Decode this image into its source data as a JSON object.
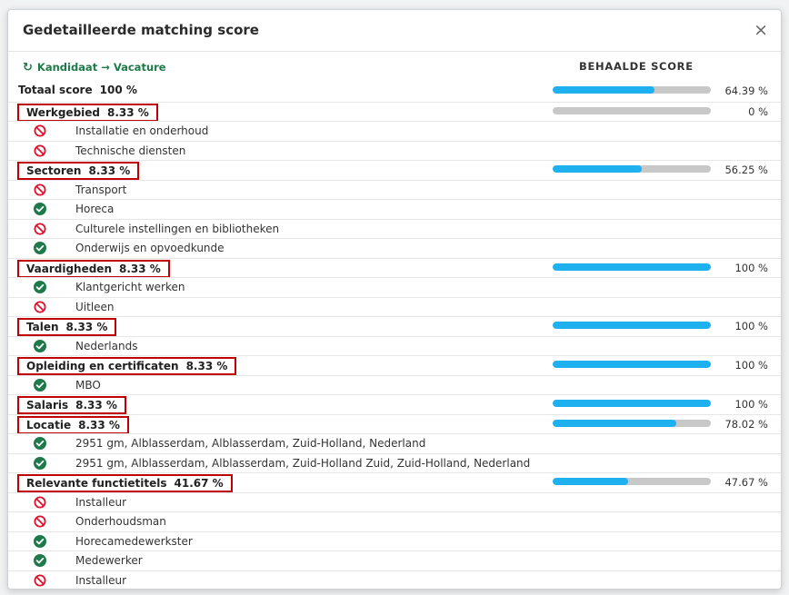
{
  "modal": {
    "title": "Gedetailleerde matching score",
    "close": "×",
    "direction_label": "Kandidaat → Vacature",
    "score_header": "BEHAALDE SCORE"
  },
  "rows": [
    {
      "kind": "cat",
      "label": "Totaal score",
      "pct": "100 %",
      "boxed": false,
      "bar": 0.6439,
      "score": "64.39 %"
    },
    {
      "kind": "cat",
      "label": "Werkgebied",
      "pct": "8.33 %",
      "boxed": true,
      "bar": 0,
      "score": "0 %"
    },
    {
      "kind": "item",
      "status": "no",
      "text": "Installatie en onderhoud"
    },
    {
      "kind": "item",
      "status": "no",
      "text": "Technische diensten"
    },
    {
      "kind": "cat",
      "label": "Sectoren",
      "pct": "8.33 %",
      "boxed": true,
      "bar": 0.5625,
      "score": "56.25 %"
    },
    {
      "kind": "item",
      "status": "no",
      "text": "Transport"
    },
    {
      "kind": "item",
      "status": "yes",
      "text": "Horeca"
    },
    {
      "kind": "item",
      "status": "no",
      "text": "Culturele instellingen en bibliotheken"
    },
    {
      "kind": "item",
      "status": "yes",
      "text": "Onderwijs en opvoedkunde"
    },
    {
      "kind": "cat",
      "label": "Vaardigheden",
      "pct": "8.33 %",
      "boxed": true,
      "bar": 1,
      "score": "100 %"
    },
    {
      "kind": "item",
      "status": "yes",
      "text": "Klantgericht werken"
    },
    {
      "kind": "item",
      "status": "no",
      "text": "Uitleen"
    },
    {
      "kind": "cat",
      "label": "Talen",
      "pct": "8.33 %",
      "boxed": true,
      "bar": 1,
      "score": "100 %"
    },
    {
      "kind": "item",
      "status": "yes",
      "text": "Nederlands"
    },
    {
      "kind": "cat",
      "label": "Opleiding en certificaten",
      "pct": "8.33 %",
      "boxed": true,
      "bar": 1,
      "score": "100 %"
    },
    {
      "kind": "item",
      "status": "yes",
      "text": "MBO"
    },
    {
      "kind": "cat",
      "label": "Salaris",
      "pct": "8.33 %",
      "boxed": true,
      "bar": 1,
      "score": "100 %"
    },
    {
      "kind": "cat",
      "label": "Locatie",
      "pct": "8.33 %",
      "boxed": true,
      "bar": 0.7802,
      "score": "78.02 %"
    },
    {
      "kind": "item",
      "status": "yes",
      "text": "2951 gm, Alblasserdam, Alblasserdam, Zuid-Holland, Nederland"
    },
    {
      "kind": "item",
      "status": "yes",
      "text": "2951 gm, Alblasserdam, Alblasserdam, Zuid-Holland Zuid, Zuid-Holland, Nederland"
    },
    {
      "kind": "cat",
      "label": "Relevante functietitels",
      "pct": "41.67 %",
      "boxed": true,
      "bar": 0.4767,
      "score": "47.67 %"
    },
    {
      "kind": "item",
      "status": "no",
      "text": "Installeur"
    },
    {
      "kind": "item",
      "status": "no",
      "text": "Onderhoudsman"
    },
    {
      "kind": "item",
      "status": "yes",
      "text": "Horecamedewerkster"
    },
    {
      "kind": "item",
      "status": "yes",
      "text": "Medewerker"
    },
    {
      "kind": "item",
      "status": "no",
      "text": "Installeur"
    }
  ],
  "colors": {
    "accent_green": "#1e7a4a",
    "bar_fill": "#1fb0f0",
    "bar_track": "#c8c8c8",
    "box_red": "#c00000",
    "yes": "#1e7a4a",
    "no": "#e0102a"
  },
  "icons": {
    "direction": "redo-arrow-icon",
    "yes": "check-circle-icon",
    "no": "prohibited-icon"
  }
}
